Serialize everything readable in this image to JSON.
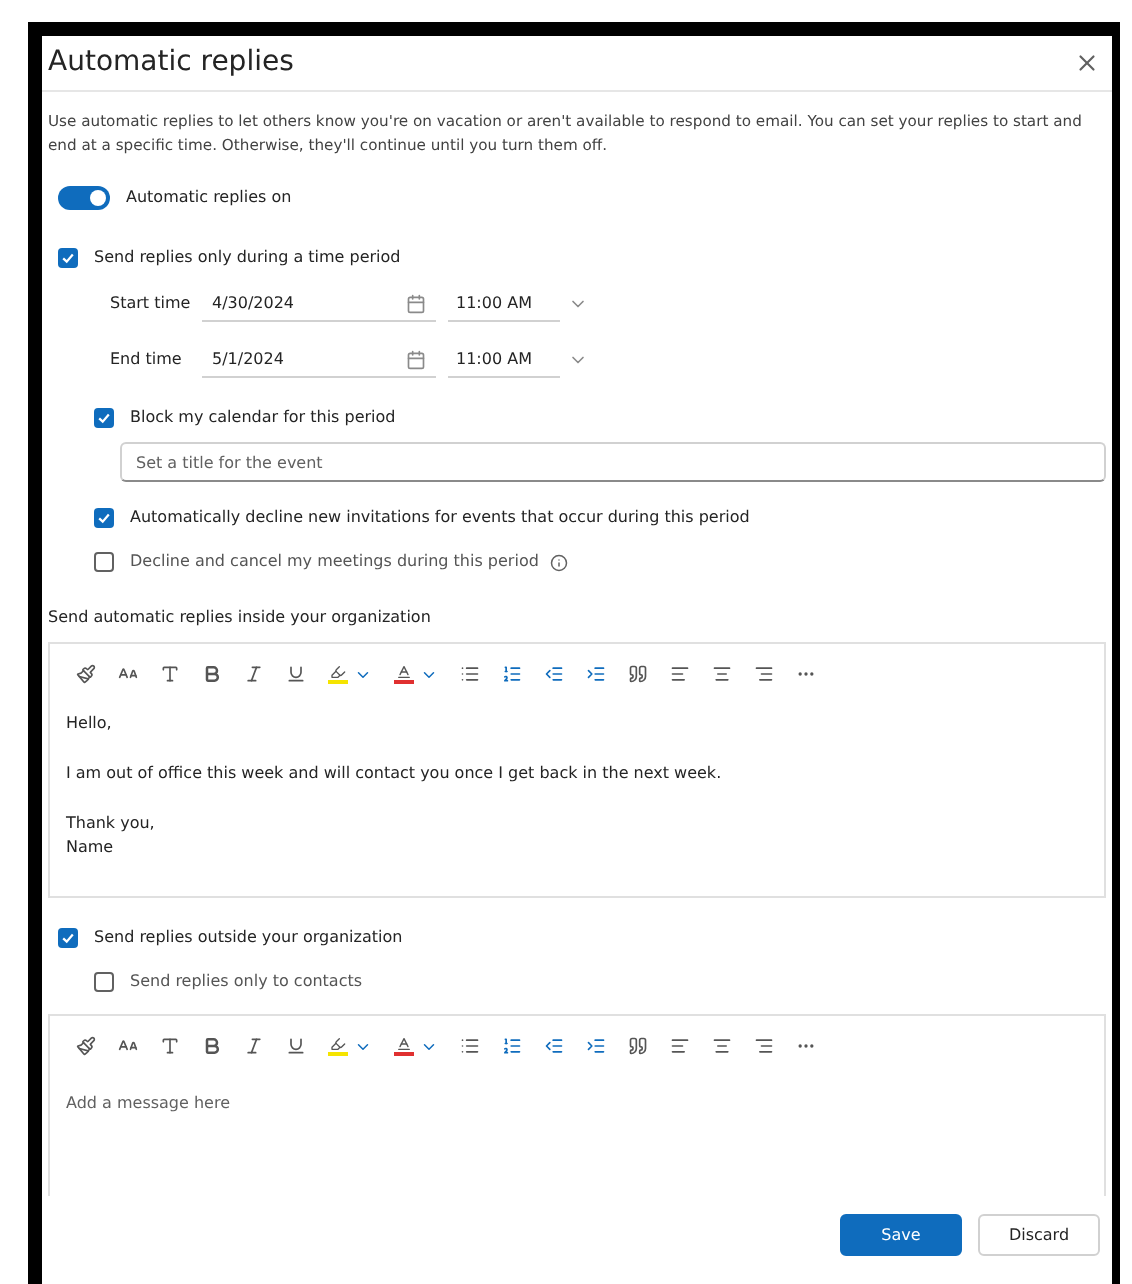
{
  "dialog": {
    "title": "Automatic replies",
    "description": "Use automatic replies to let others know you're on vacation or aren't available to respond to email. You can set your replies to start and end at a specific time. Otherwise, they'll continue until you turn them off.",
    "toggle": {
      "label": "Automatic replies on",
      "on": true
    },
    "time_period": {
      "label": "Send replies only during a time period",
      "checked": true,
      "times": [
        {
          "label": "Start time",
          "date": "4/30/2024",
          "time": "11:00 AM"
        },
        {
          "label": "End time",
          "date": "5/1/2024",
          "time": "11:00 AM"
        }
      ],
      "options": [
        {
          "label": "Block my calendar for this period",
          "checked": true,
          "info": false,
          "event_title": {
            "placeholder": "Set a title for the event"
          }
        },
        {
          "label": "Automatically decline new invitations for events that occur during this period",
          "checked": true,
          "info": false
        },
        {
          "label": "Decline and cancel my meetings during this period",
          "checked": false,
          "info": true
        }
      ]
    },
    "inside": {
      "heading": "Send automatic replies inside your organization",
      "message": [
        [
          "Hello,"
        ],
        [
          "I am out of office this week and will contact you once I get back in the next week."
        ],
        [
          "Thank you,",
          "Name"
        ]
      ]
    },
    "outside": {
      "label": "Send replies outside your organization",
      "checked": true,
      "contacts_only": {
        "label": "Send replies only to contacts",
        "checked": false
      },
      "message": {
        "placeholder": "Add a message here"
      }
    },
    "buttons": [
      {
        "label": "Save",
        "kind": "primary"
      },
      {
        "label": "Discard",
        "kind": "secondary"
      }
    ]
  }
}
